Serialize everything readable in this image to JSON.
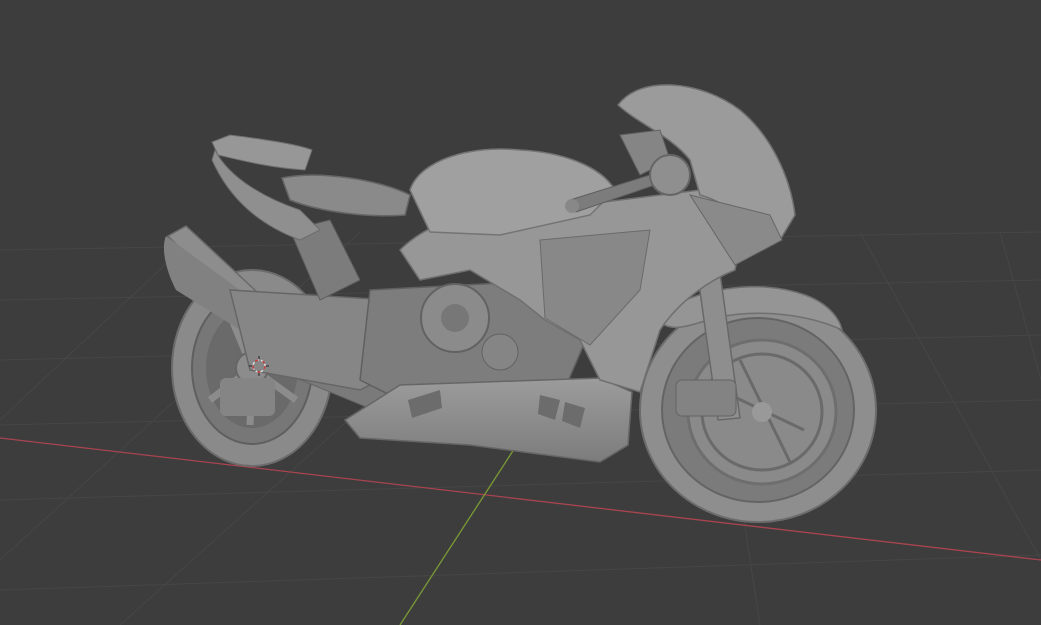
{
  "viewport": {
    "background_color": "#3d3d3d",
    "grid_color": "#474747",
    "x_axis_color": "#a8444f",
    "y_axis_color": "#7a9a34"
  },
  "scene": {
    "object_name_icon": "motorcycle-model-icon",
    "model_color": "#8c8c8c",
    "model_shadow_color": "#6b6b6b",
    "model_highlight_color": "#a6a6a6",
    "origin_marker_icon": "3d-cursor-icon"
  }
}
